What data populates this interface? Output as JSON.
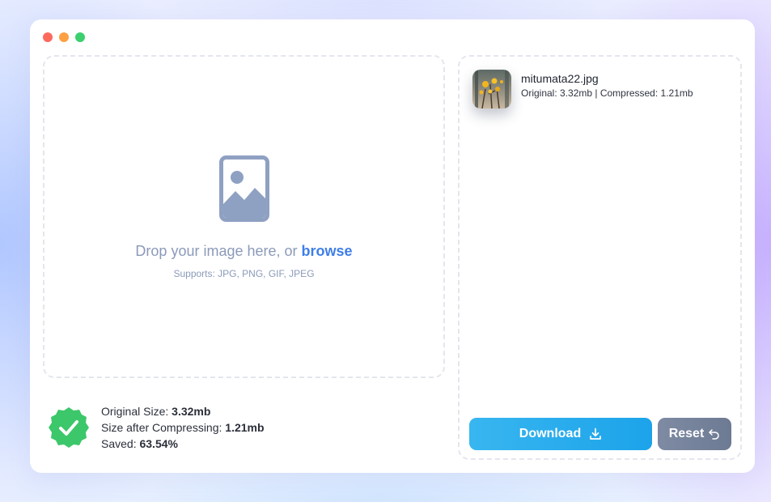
{
  "window": {
    "controls": [
      "close",
      "minimize",
      "maximize"
    ]
  },
  "dropzone": {
    "icon": "image-icon",
    "prompt": "Drop your image here, or",
    "browse_label": "browse",
    "supports": "Supports: JPG, PNG, GIF, JPEG"
  },
  "stats": {
    "badge_icon": "check-badge-icon",
    "original_label": "Original Size:",
    "original_value": "3.32mb",
    "compressed_label": "Size after Compressing:",
    "compressed_value": "1.21mb",
    "saved_label": "Saved:",
    "saved_value": "63.54%"
  },
  "files": [
    {
      "name": "mitumata22.jpg",
      "sizes": "Original: 3.32mb | Compressed: 1.21mb"
    }
  ],
  "actions": {
    "download_label": "Download",
    "download_icon": "download-icon",
    "reset_label": "Reset",
    "reset_icon": "undo-icon"
  },
  "colors": {
    "accent": "#3f7ee8",
    "download": "#1ca3ea",
    "reset": "#76839b",
    "success": "#3cc76a",
    "muted": "#8b9ab9"
  }
}
